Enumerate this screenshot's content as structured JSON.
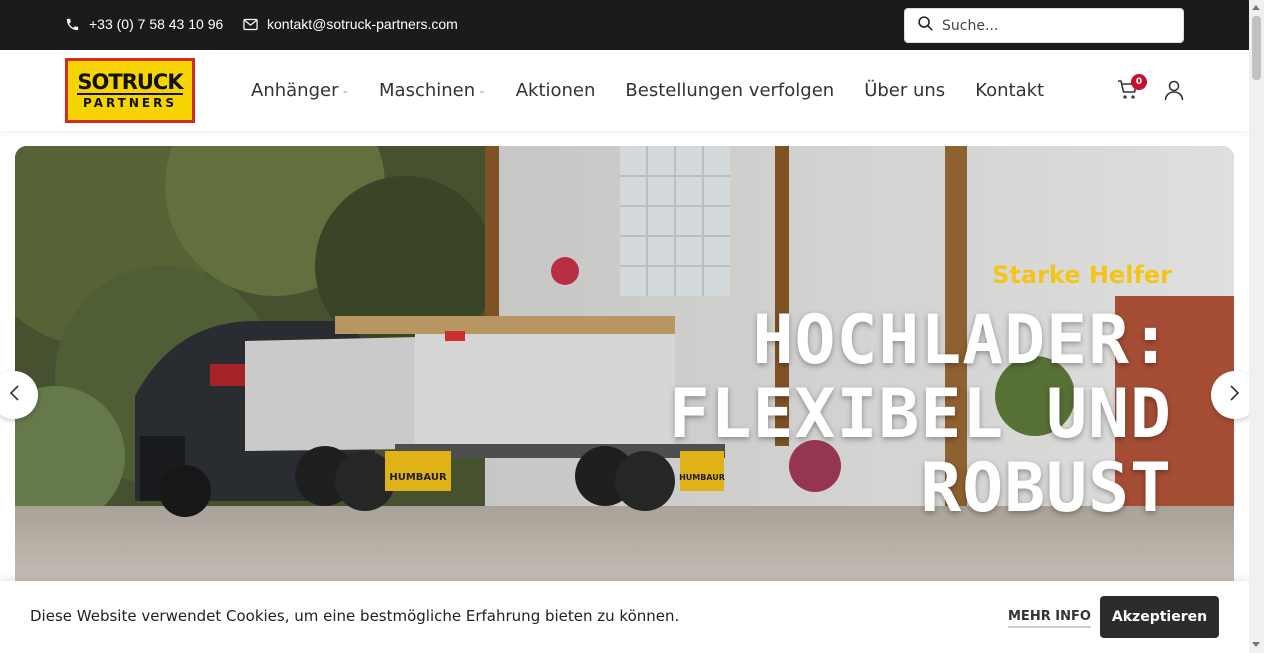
{
  "topbar": {
    "phone": "+33 (0) 7 58 43 10 96",
    "phone_icon": "phone-icon",
    "email": "kontakt@sotruck-partners.com",
    "email_icon": "envelope-icon",
    "search_placeholder": "Suche...",
    "search_icon": "search-icon"
  },
  "logo": {
    "line1": "SOTRUCK",
    "line2": "PARTNERS"
  },
  "nav": {
    "items": [
      {
        "label": "Anhänger",
        "has_dropdown": true
      },
      {
        "label": "Maschinen",
        "has_dropdown": true
      },
      {
        "label": "Aktionen",
        "has_dropdown": false
      },
      {
        "label": "Bestellungen verfolgen",
        "has_dropdown": false
      },
      {
        "label": "Über uns",
        "has_dropdown": false
      },
      {
        "label": "Kontakt",
        "has_dropdown": false
      }
    ],
    "cart_count": "0",
    "cart_icon": "shopping-cart-icon",
    "user_icon": "user-icon"
  },
  "hero": {
    "subtitle": "Starke Helfer",
    "title_line1": "HOCHLADER:",
    "title_line2": "FLEXIBEL UND",
    "title_line3": "ROBUST",
    "trailer_brand": "HUMBAUR"
  },
  "cookie": {
    "message": "Diese Website verwendet Cookies, um eine bestmögliche Erfahrung bieten zu können.",
    "more_info": "MEHR INFO",
    "accept": "Akzeptieren"
  },
  "colors": {
    "topbar_bg": "#1b1b1b",
    "accent_yellow": "#f3c51b",
    "logo_yellow": "#f5d400",
    "logo_red": "#d22c1e",
    "badge_red": "#c8102e",
    "accept_bg": "#2c2c2c"
  }
}
